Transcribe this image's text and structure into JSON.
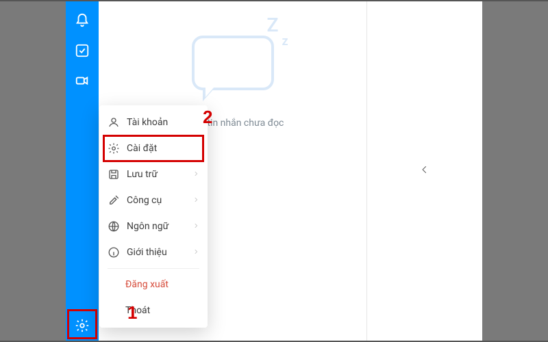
{
  "sidebar": {
    "icons": [
      "bell",
      "checkbox",
      "video",
      "gear"
    ]
  },
  "menu": {
    "items": [
      {
        "icon": "user",
        "label": "Tài khoản",
        "chev": false
      },
      {
        "icon": "gear",
        "label": "Cài đặt",
        "chev": false
      },
      {
        "icon": "save",
        "label": "Lưu trữ",
        "chev": true
      },
      {
        "icon": "tools",
        "label": "Công cụ",
        "chev": true
      },
      {
        "icon": "globe",
        "label": "Ngôn ngữ",
        "chev": true
      },
      {
        "icon": "info",
        "label": "Giới thiệu",
        "chev": true
      }
    ],
    "logout": "Đăng xuất",
    "quit": "Thoát"
  },
  "empty_state": {
    "text": "Không có tin nhắn chưa đọc",
    "visible_fragment": "ng có tin nhắn chưa đọc"
  },
  "annotations": {
    "gear": "1",
    "setting": "2"
  },
  "colors": {
    "brand": "#0091ff",
    "highlight": "#d40000"
  }
}
